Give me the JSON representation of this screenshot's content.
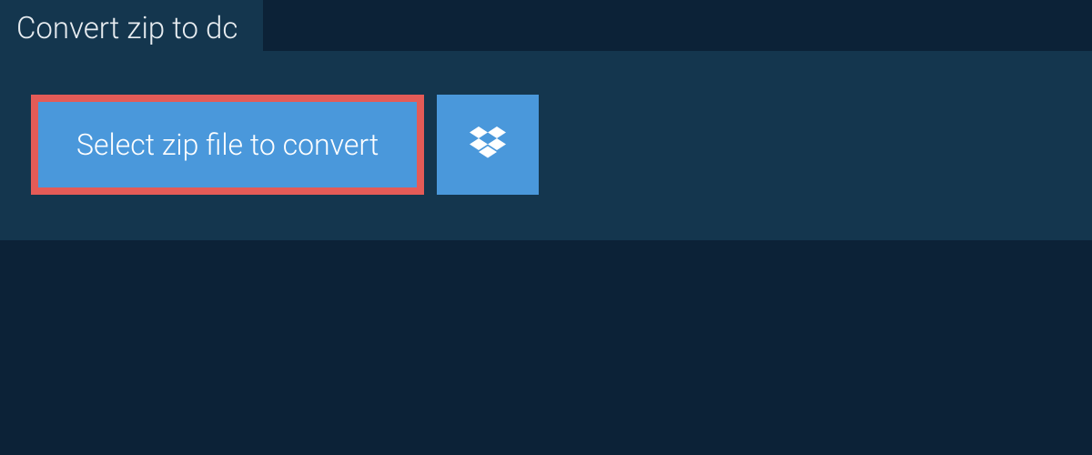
{
  "tab": {
    "title": "Convert zip to dc"
  },
  "actions": {
    "select_label": "Select zip file to convert"
  }
}
